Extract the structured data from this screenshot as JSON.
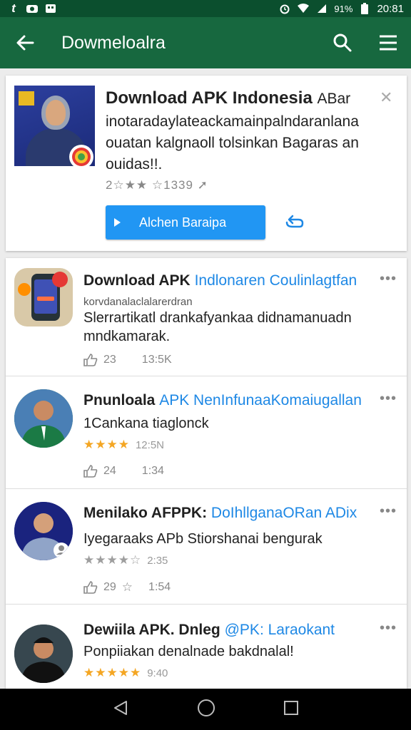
{
  "status_bar": {
    "left_icons": [
      "notification-t-icon",
      "camera-icon",
      "message-icon"
    ],
    "battery": "91%",
    "time": "20:81"
  },
  "app_bar": {
    "title": "Dowmeloalra",
    "icons": [
      "back-arrow-icon",
      "search-icon",
      "menu-icon"
    ]
  },
  "featured": {
    "title": "Download APK Indonesia",
    "title_suffix": "ABar",
    "description": "inotaradaylateackamainpalndaranlana ouatan kalgnaoll tolsinkan Bagaras an ouidas!!.",
    "rating_text": "2☆★★ ☆1339 ➚",
    "button_label": "Alchen Baraipa"
  },
  "items": [
    {
      "title": "Download APK",
      "title_highlight": "Indlonaren Coulinlagtfan",
      "subtitle": "korvdanalaclalarerdran",
      "line1": "Slerrartikatl drankafyankaa didnamanuadn",
      "line2": "mndkamarak.",
      "likes": "23",
      "time": "13:5K"
    },
    {
      "title": "Pnunloala",
      "title_highlight": "APK NenInfunaaKomaiugallan",
      "line1": "1Cankana tiaglonck",
      "stars": "★★★★",
      "star_time": "12:5N",
      "likes": "24",
      "time": "1:34"
    },
    {
      "title": "Menilako AFPPK:",
      "title_highlight": "DoIhllganaORan ADix",
      "line1": "Iyegaraaks APb Stiorshanai bengurak",
      "stars": "★★★★☆",
      "star_time": "2:35",
      "likes": "29",
      "time": "1:54"
    },
    {
      "title": "Dewiila APK. Dnleg",
      "title_highlight": "@PK: Laraokant",
      "line1": "Ponpiiakan denalnade bakdnalal!",
      "stars": "★★★★★",
      "star_time": "9:40"
    }
  ],
  "more_label": "•••",
  "colors": {
    "status_bar": "#0b4f2e",
    "app_bar": "#17683f",
    "accent_blue": "#2196f3",
    "star": "#f4a623"
  }
}
